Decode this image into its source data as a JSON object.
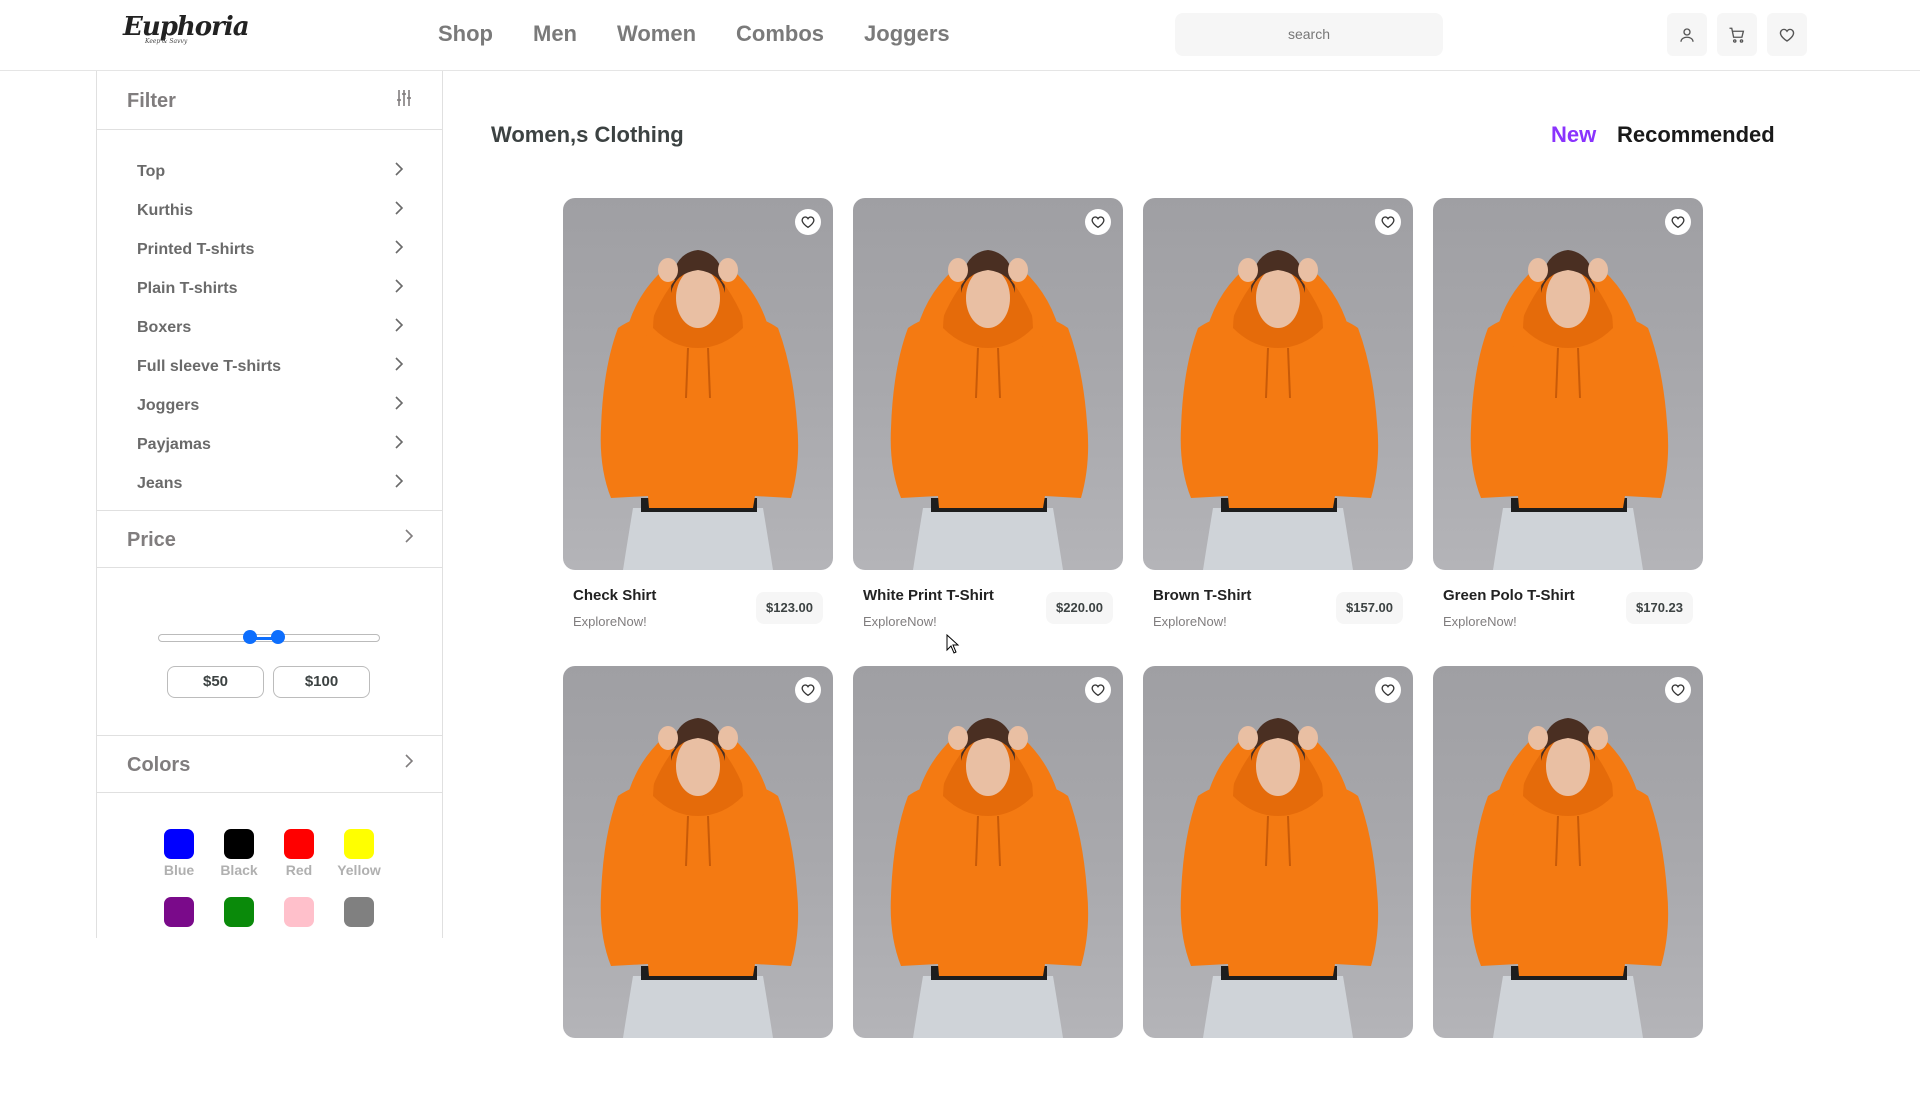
{
  "header": {
    "logo_text": "Euphoria",
    "logo_tagline": "Keep & Savvy",
    "nav": [
      "Shop",
      "Men",
      "Women",
      "Combos",
      "Joggers"
    ],
    "search_placeholder": "search",
    "icons": [
      "user-icon",
      "cart-icon",
      "heart-icon"
    ]
  },
  "sidebar": {
    "filter_title": "Filter",
    "categories": [
      "Top",
      "Kurthis",
      "Printed T-shirts",
      "Plain T-shirts",
      "Boxers",
      "Full sleeve T-shirts",
      "Joggers",
      "Payjamas",
      "Jeans"
    ],
    "price_title": "Price",
    "price_min": "$50",
    "price_max": "$100",
    "colors_title": "Colors",
    "colors": [
      {
        "name": "Blue",
        "hex": "#0000ff"
      },
      {
        "name": "Black",
        "hex": "#000000"
      },
      {
        "name": "Red",
        "hex": "#ff0000"
      },
      {
        "name": "Yellow",
        "hex": "#ffff00"
      }
    ],
    "colors_row2_hex": [
      "#7a0a8a",
      "#0a8a0a",
      "#ffc0cb",
      "#808080"
    ]
  },
  "main": {
    "title": "Women,s Clothing",
    "sort_new": "New",
    "sort_recommended": "Recommended",
    "accent_color": "#8a33fd",
    "products": [
      {
        "name": "Check Shirt",
        "brand": "ExploreNow!",
        "price": "$123.00"
      },
      {
        "name": "White Print T-Shirt",
        "brand": "ExploreNow!",
        "price": "$220.00"
      },
      {
        "name": "Brown T-Shirt",
        "brand": "ExploreNow!",
        "price": "$157.00"
      },
      {
        "name": "Green Polo T-Shirt",
        "brand": "ExploreNow!",
        "price": "$170.23"
      }
    ]
  }
}
